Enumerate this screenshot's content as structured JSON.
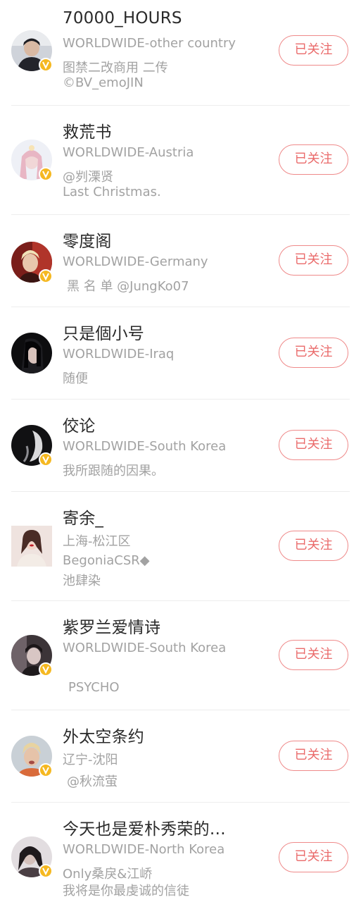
{
  "follow_list": {
    "accent_color": "#ea6a6a",
    "verified_badge_color": "#f5b821",
    "items": [
      {
        "name": "70000_HOURS",
        "lines": [
          "WORLDWIDE-other country",
          "图禁二改商用 二传",
          "©BV_emoJIN"
        ],
        "verified": true,
        "follow_label": "已关注"
      },
      {
        "name": "救荒书",
        "lines": [
          "WORLDWIDE-Austria",
          "@刿溧贤",
          "Last Christmas."
        ],
        "verified": true,
        "follow_label": "已关注"
      },
      {
        "name": "零度阁",
        "lines": [
          "WORLDWIDE-Germany",
          "黑 名 单 @JungKo07"
        ],
        "verified": true,
        "follow_label": "已关注"
      },
      {
        "name": "只是個小号",
        "lines": [
          "WORLDWIDE-Iraq",
          "随便"
        ],
        "verified": false,
        "follow_label": "已关注"
      },
      {
        "name": "佼论",
        "lines": [
          "WORLDWIDE-South Korea",
          "我所跟随的因果。"
        ],
        "verified": true,
        "follow_label": "已关注"
      },
      {
        "name": "寄余_",
        "lines": [
          "上海-松江区",
          "BegoniaCSR◆",
          "池肆染"
        ],
        "verified": false,
        "follow_label": "已关注"
      },
      {
        "name": "紫罗兰爱情诗",
        "lines": [
          "WORLDWIDE-South Korea",
          "PSYCHO"
        ],
        "verified": true,
        "follow_label": "已关注"
      },
      {
        "name": "外太空条约",
        "lines": [
          "辽宁-沈阳",
          "@秋流萤"
        ],
        "verified": true,
        "follow_label": "已关注"
      },
      {
        "name": "今天也是爱朴秀荣的…",
        "lines": [
          "WORLDWIDE-North Korea",
          "Only桑戾&江峤",
          "我将是你最虔诚的信徒"
        ],
        "verified": true,
        "follow_label": "已关注"
      }
    ]
  }
}
